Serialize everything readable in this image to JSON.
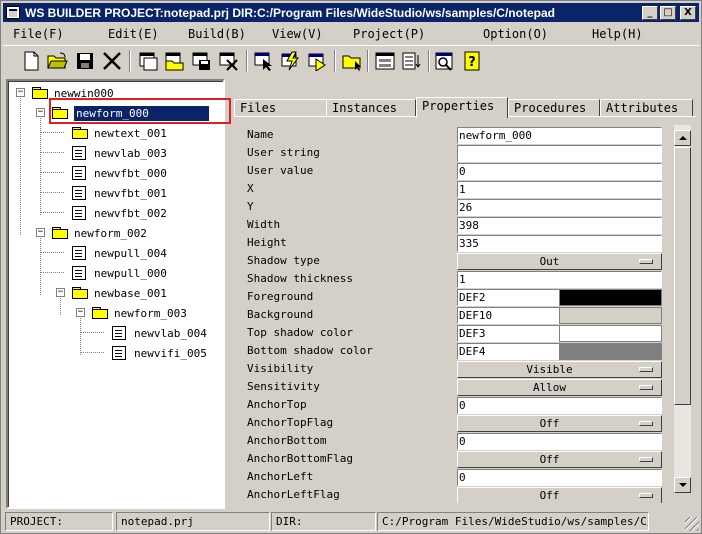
{
  "window": {
    "title": "WS BUILDER PROJECT:notepad.prj DIR:C:/Program Files/WideStudio/ws/samples/C/notepad",
    "controls": {
      "minimize": "_",
      "maximize": "□",
      "close": "X"
    }
  },
  "menu": [
    {
      "label": "File(F)"
    },
    {
      "label": "Edit(E)"
    },
    {
      "label": "Build(B)"
    },
    {
      "label": "View(V)"
    },
    {
      "label": "Project(P)"
    },
    {
      "label": "Option(O)"
    },
    {
      "label": "Help(H)"
    }
  ],
  "toolbar": {
    "icons": [
      "new-icon",
      "open-folder-icon",
      "save-icon",
      "cut-icon",
      "new-window-icon",
      "open-window-icon",
      "save-window-icon",
      "close-window-icon",
      "select-icon",
      "build-icon",
      "run-icon",
      "folder-open-icon",
      "dialog-icon",
      "list-icon",
      "search-icon",
      "help-icon"
    ]
  },
  "tree": {
    "nodes": [
      {
        "label": "newwin000"
      },
      {
        "label": "newform_000"
      },
      {
        "label": "newtext_001"
      },
      {
        "label": "newvlab_003"
      },
      {
        "label": "newvfbt_000"
      },
      {
        "label": "newvfbt_001"
      },
      {
        "label": "newvfbt_002"
      },
      {
        "label": "newform_002"
      },
      {
        "label": "newpull_004"
      },
      {
        "label": "newpull_000"
      },
      {
        "label": "newbase_001"
      },
      {
        "label": "newform_003"
      },
      {
        "label": "newvlab_004"
      },
      {
        "label": "newvifi_005"
      }
    ]
  },
  "tabs": [
    {
      "label": "Files"
    },
    {
      "label": "Instances"
    },
    {
      "label": "Properties"
    },
    {
      "label": "Procedures"
    },
    {
      "label": "Attributes"
    }
  ],
  "properties": [
    {
      "name": "Name",
      "value": "newform_000"
    },
    {
      "name": "User string",
      "value": ""
    },
    {
      "name": "User value",
      "value": "0"
    },
    {
      "name": "X",
      "value": "1"
    },
    {
      "name": "Y",
      "value": "26"
    },
    {
      "name": "Width",
      "value": "398"
    },
    {
      "name": "Height",
      "value": "335"
    },
    {
      "name": "Shadow type",
      "value": "Out"
    },
    {
      "name": "Shadow thickness",
      "value": "1"
    },
    {
      "name": "Foreground",
      "value": "DEF2",
      "color": "#000000"
    },
    {
      "name": "Background",
      "value": "DEF10",
      "color": "#d4d0c8"
    },
    {
      "name": "Top shadow color",
      "value": "DEF3",
      "color": "#ffffff"
    },
    {
      "name": "Bottom shadow color",
      "value": "DEF4",
      "color": "#808080"
    },
    {
      "name": "Visibility",
      "value": "Visible"
    },
    {
      "name": "Sensitivity",
      "value": "Allow"
    },
    {
      "name": "AnchorTop",
      "value": "0"
    },
    {
      "name": "AnchorTopFlag",
      "value": "Off"
    },
    {
      "name": "AnchorBottom",
      "value": "0"
    },
    {
      "name": "AnchorBottomFlag",
      "value": "Off"
    },
    {
      "name": "AnchorLeft",
      "value": "0"
    },
    {
      "name": "AnchorLeftFlag",
      "value": "Off"
    }
  ],
  "status": {
    "project_label": "PROJECT:",
    "project_value": "notepad.prj",
    "dir_label": "DIR:",
    "dir_value": "C:/Program Files/WideStudio/ws/samples/C/notepad"
  }
}
